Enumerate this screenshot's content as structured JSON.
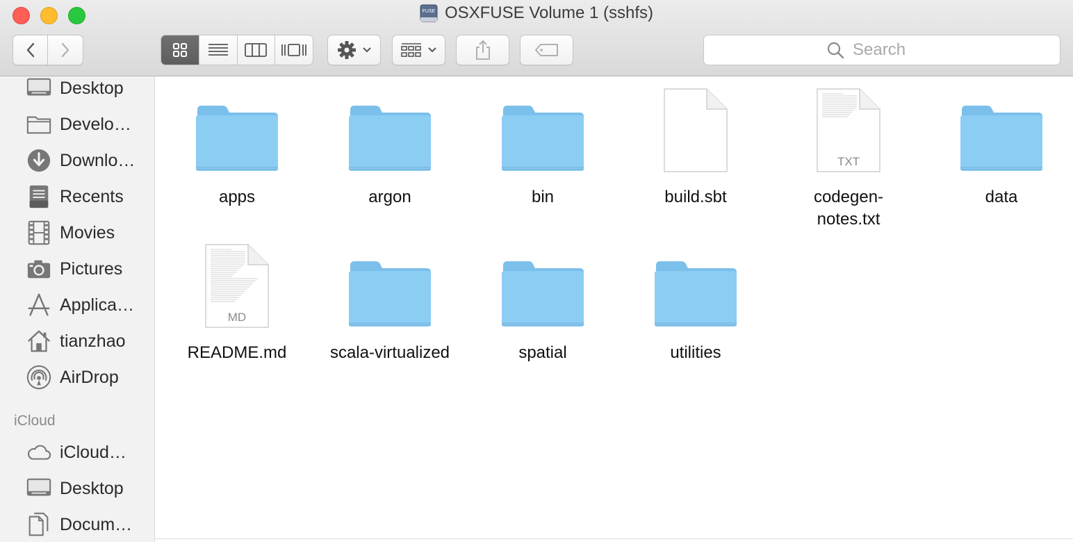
{
  "window": {
    "title": "OSXFUSE Volume 1 (sshfs)",
    "title_icon_text": "FUSE"
  },
  "toolbar": {
    "back_icon": "chevron-left-icon",
    "forward_icon": "chevron-right-icon",
    "view_modes": [
      "icon-view",
      "list-view",
      "column-view",
      "cover-flow-view"
    ],
    "active_view": "icon-view",
    "action_icon": "gear-icon",
    "arrange_icon": "arrange-grid-icon",
    "share_icon": "share-icon",
    "tag_icon": "tag-icon"
  },
  "search": {
    "placeholder": "Search",
    "value": ""
  },
  "sidebar": {
    "favorites": [
      {
        "label": "Desktop",
        "icon": "desktop-icon"
      },
      {
        "label": "Develo…",
        "icon": "folder-icon"
      },
      {
        "label": "Downlo…",
        "icon": "downloads-icon"
      },
      {
        "label": "Recents",
        "icon": "recents-icon"
      },
      {
        "label": "Movies",
        "icon": "movies-icon"
      },
      {
        "label": "Pictures",
        "icon": "camera-icon"
      },
      {
        "label": "Applica…",
        "icon": "applications-icon"
      },
      {
        "label": "tianzhao",
        "icon": "home-icon"
      },
      {
        "label": "AirDrop",
        "icon": "airdrop-icon"
      }
    ],
    "icloud_heading": "iCloud",
    "icloud": [
      {
        "label": "iCloud…",
        "icon": "cloud-icon"
      },
      {
        "label": "Desktop",
        "icon": "desktop-icon"
      },
      {
        "label": "Docum…",
        "icon": "documents-icon"
      }
    ]
  },
  "files": [
    {
      "name": "apps",
      "kind": "folder"
    },
    {
      "name": "argon",
      "kind": "folder"
    },
    {
      "name": "bin",
      "kind": "folder"
    },
    {
      "name": "build.sbt",
      "kind": "document",
      "badge": ""
    },
    {
      "name": "codegen-\nnotes.txt",
      "kind": "document",
      "badge": "TXT"
    },
    {
      "name": "data",
      "kind": "folder"
    },
    {
      "name": "README.md",
      "kind": "document",
      "badge": "MD"
    },
    {
      "name": "scala-virtualized",
      "kind": "folder"
    },
    {
      "name": "spatial",
      "kind": "folder"
    },
    {
      "name": "utilities",
      "kind": "folder"
    }
  ],
  "colors": {
    "folder_body": "#8ccdf4",
    "folder_tab": "#7bbfeb",
    "active_view_button": "#636363",
    "sidebar_bg": "#f2f2f2"
  }
}
